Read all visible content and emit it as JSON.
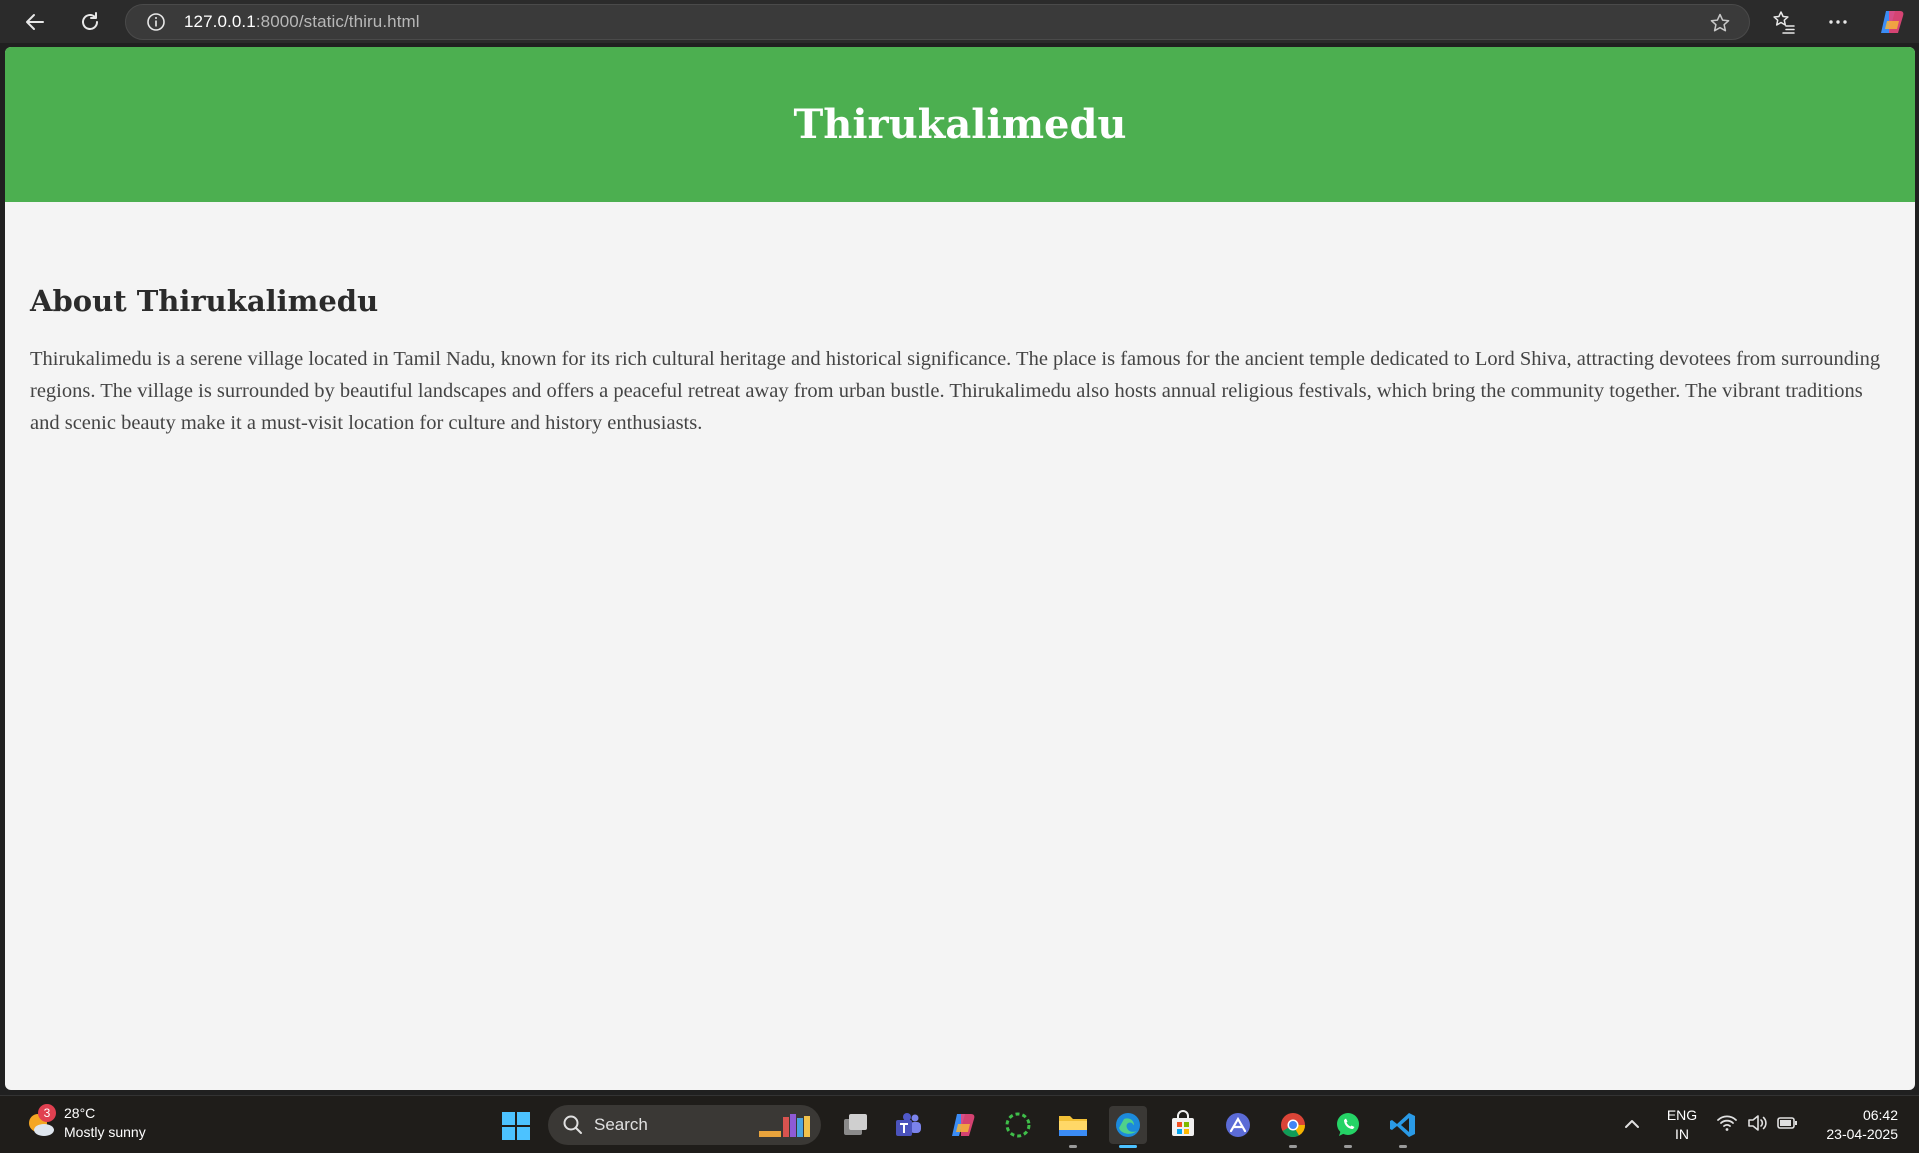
{
  "browser": {
    "url_host": "127.0.0.1",
    "url_path": ":8000/static/thiru.html"
  },
  "page": {
    "title": "Thirukalimedu",
    "about_heading": "About Thirukalimedu",
    "about_text": "Thirukalimedu is a serene village located in Tamil Nadu, known for its rich cultural heritage and historical significance. The place is famous for the ancient temple dedicated to Lord Shiva, attracting devotees from surrounding regions. The village is surrounded by beautiful landscapes and offers a peaceful retreat away from urban bustle. Thirukalimedu also hosts annual religious festivals, which bring the community together. The vibrant traditions and scenic beauty make it a must-visit location for culture and history enthusiasts."
  },
  "colors": {
    "header_green": "#4caf50",
    "page_bg": "#f4f4f4"
  },
  "taskbar": {
    "weather_badge": "3",
    "temperature": "28°C",
    "condition": "Mostly sunny",
    "search_label": "Search",
    "lang_line1": "ENG",
    "lang_line2": "IN",
    "time": "06:42",
    "date": "23-04-2025",
    "apps": [
      "task-view",
      "teams",
      "copilot",
      "circular-app",
      "file-explorer",
      "edge",
      "microsoft-store",
      "arc-app",
      "chrome",
      "whatsapp",
      "vscode"
    ]
  }
}
